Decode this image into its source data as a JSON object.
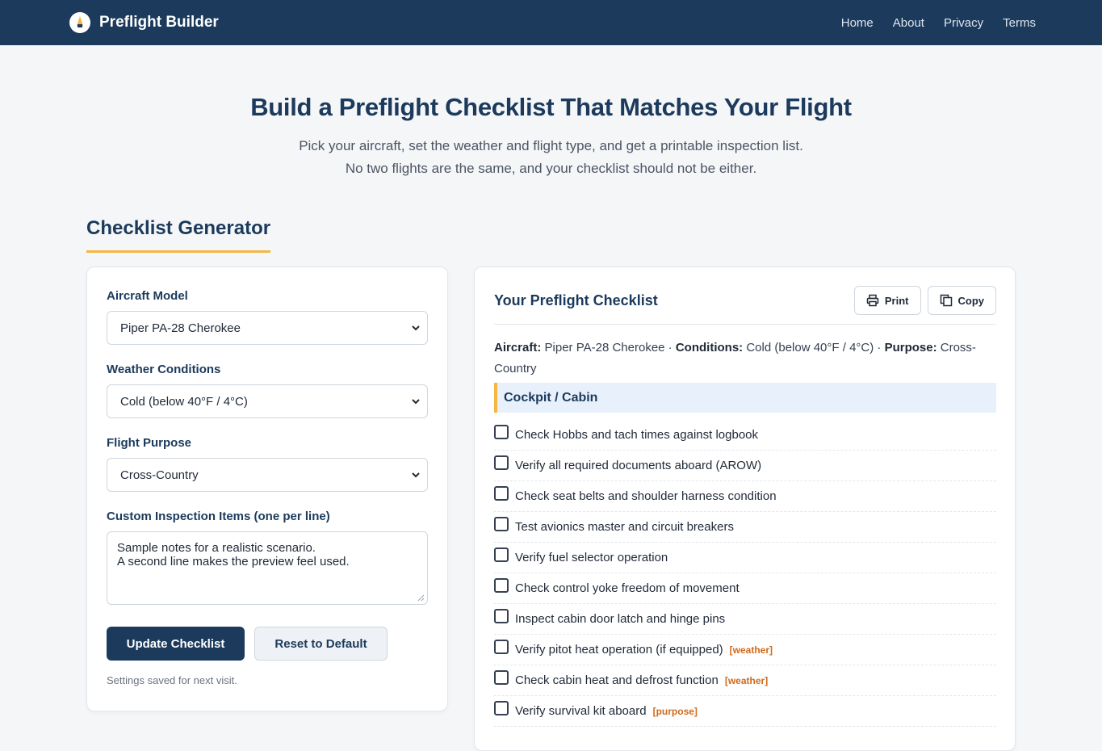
{
  "brand": {
    "name": "Preflight Builder"
  },
  "nav": [
    "Home",
    "About",
    "Privacy",
    "Terms"
  ],
  "hero": {
    "title": "Build a Preflight Checklist That Matches Your Flight",
    "line1": "Pick your aircraft, set the weather and flight type, and get a printable inspection list.",
    "line2": "No two flights are the same, and your checklist should not be either."
  },
  "section": {
    "title": "Checklist Generator"
  },
  "form": {
    "aircraft_label": "Aircraft Model",
    "aircraft_value": "Piper PA-28 Cherokee",
    "weather_label": "Weather Conditions",
    "weather_value": "Cold (below 40°F / 4°C)",
    "purpose_label": "Flight Purpose",
    "purpose_value": "Cross-Country",
    "custom_label": "Custom Inspection Items (one per line)",
    "custom_line1": "Sample notes for a realistic scenario.",
    "custom_line2": "A second line makes the preview feel used.",
    "update_label": "Update Checklist",
    "reset_label": "Reset to Default",
    "saved_note": "Settings saved for next visit."
  },
  "output": {
    "title": "Your Preflight Checklist",
    "print_label": "Print",
    "copy_label": "Copy",
    "summary": {
      "aircraft_key": "Aircraft:",
      "aircraft_val": "Piper PA-28 Cherokee",
      "sep": "·",
      "conditions_key": "Conditions:",
      "conditions_val": "Cold (below 40°F / 4°C)",
      "purpose_key": "Purpose:",
      "purpose_val": "Cross-Country"
    },
    "group": "Cockpit / Cabin",
    "items": [
      {
        "text": "Check Hobbs and tach times against logbook",
        "tag": ""
      },
      {
        "text": "Verify all required documents aboard (AROW)",
        "tag": ""
      },
      {
        "text": "Check seat belts and shoulder harness condition",
        "tag": ""
      },
      {
        "text": "Test avionics master and circuit breakers",
        "tag": ""
      },
      {
        "text": "Verify fuel selector operation",
        "tag": ""
      },
      {
        "text": "Check control yoke freedom of movement",
        "tag": ""
      },
      {
        "text": "Inspect cabin door latch and hinge pins",
        "tag": ""
      },
      {
        "text": "Verify pitot heat operation (if equipped)",
        "tag": "[weather]"
      },
      {
        "text": "Check cabin heat and defrost function",
        "tag": "[weather]"
      },
      {
        "text": "Verify survival kit aboard",
        "tag": "[purpose]"
      }
    ]
  },
  "colors": {
    "navy": "#1b3a5c",
    "accent": "#f5b642",
    "tag": "#d06a1a"
  }
}
